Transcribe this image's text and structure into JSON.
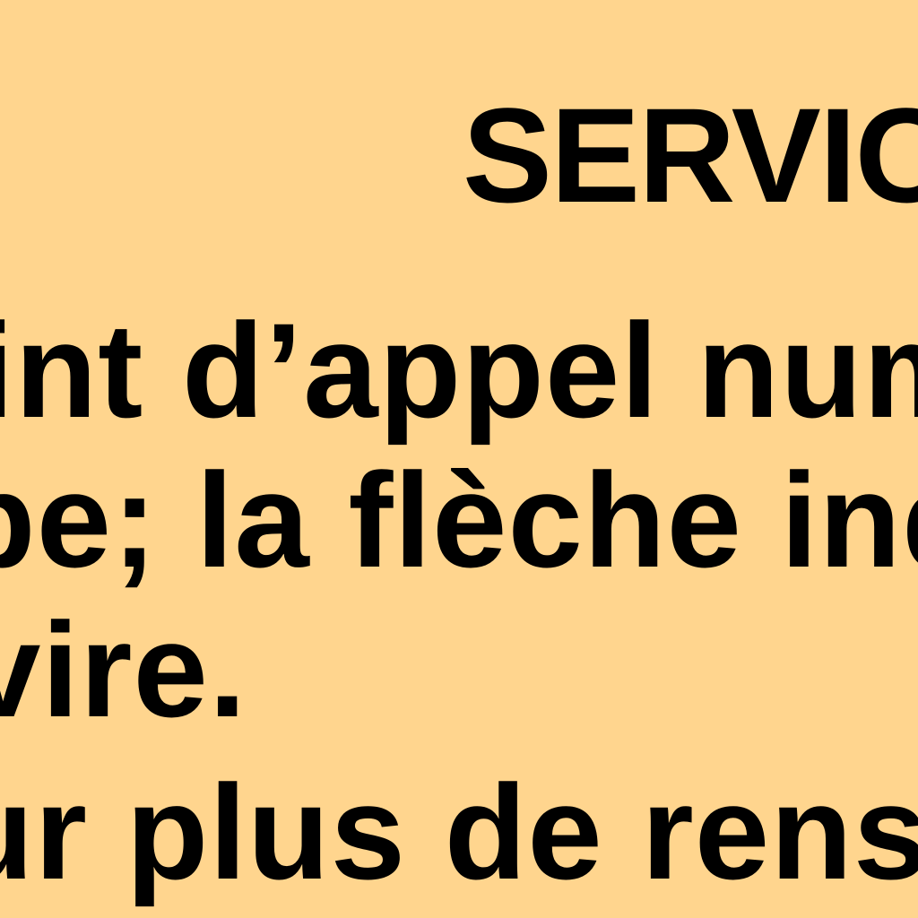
{
  "colors": {
    "background": "#FFD58E",
    "text": "#000000"
  },
  "notice": {
    "heading": "SERVICE",
    "lines": [
      "int d’appel num",
      "pe; la flèche ind",
      "vire.",
      "ur plus de rense"
    ]
  }
}
